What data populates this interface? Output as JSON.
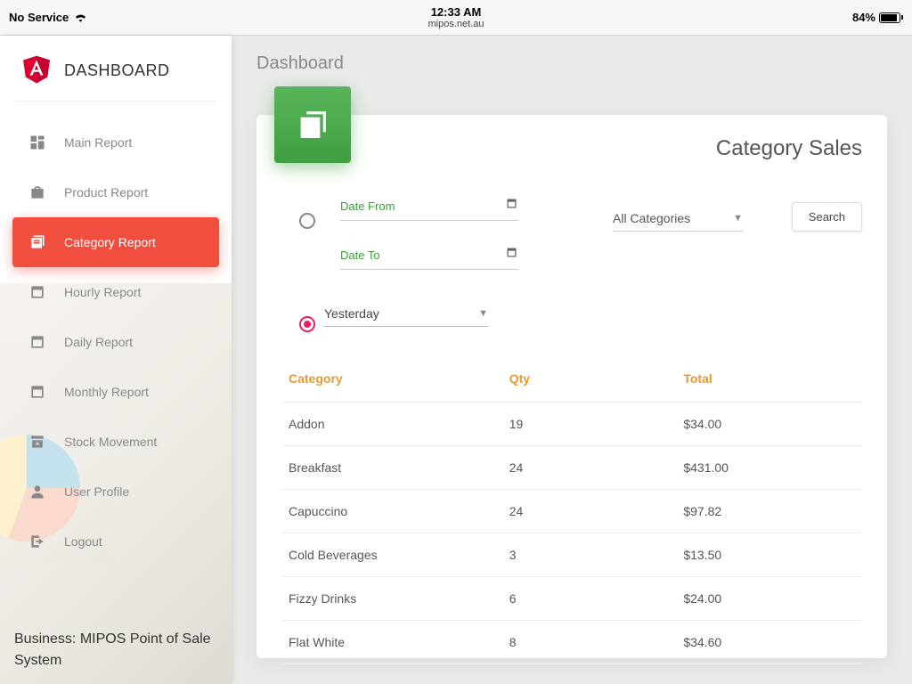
{
  "statusbar": {
    "service": "No Service",
    "time": "12:33 AM",
    "url": "mipos.net.au",
    "battery_pct": "84%"
  },
  "sidebar": {
    "brand": "DASHBOARD",
    "items": [
      {
        "label": "Main Report"
      },
      {
        "label": "Product Report"
      },
      {
        "label": "Category Report"
      },
      {
        "label": "Hourly Report"
      },
      {
        "label": "Daily Report"
      },
      {
        "label": "Monthly Report"
      },
      {
        "label": "Stock Movement"
      },
      {
        "label": "User Profile"
      },
      {
        "label": "Logout"
      }
    ],
    "footer": "Business: MIPOS Point of Sale System"
  },
  "page": {
    "title": "Dashboard",
    "card_title": "Category Sales",
    "date_from_label": "Date From",
    "date_to_label": "Date To",
    "category_selected": "All Categories",
    "search_label": "Search",
    "preset_selected": "Yesterday"
  },
  "table": {
    "headers": {
      "category": "Category",
      "qty": "Qty",
      "total": "Total"
    },
    "rows": [
      {
        "category": "Addon",
        "qty": "19",
        "total": "$34.00"
      },
      {
        "category": "Breakfast",
        "qty": "24",
        "total": "$431.00"
      },
      {
        "category": "Capuccino",
        "qty": "24",
        "total": "$97.82"
      },
      {
        "category": "Cold Beverages",
        "qty": "3",
        "total": "$13.50"
      },
      {
        "category": "Fizzy Drinks",
        "qty": "6",
        "total": "$24.00"
      },
      {
        "category": "Flat White",
        "qty": "8",
        "total": "$34.60"
      }
    ]
  },
  "colors": {
    "accent": "#f04e3e",
    "tile": "#4caf50",
    "header_text": "#e69a31",
    "radio_active": "#e91e63"
  }
}
